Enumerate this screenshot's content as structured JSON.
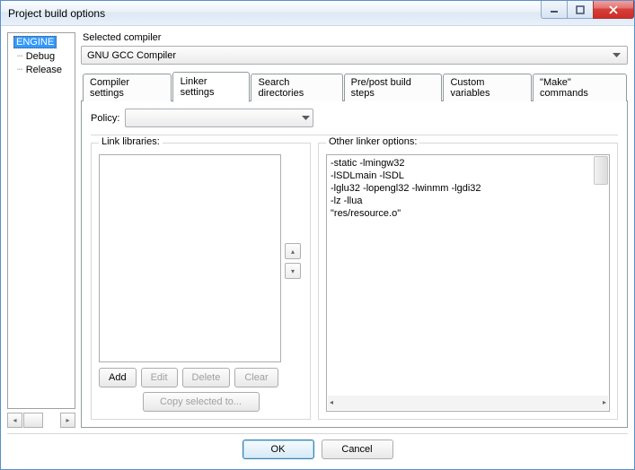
{
  "window": {
    "title": "Project build options"
  },
  "tree": {
    "root": "ENGINE",
    "children": [
      "Debug",
      "Release"
    ]
  },
  "compiler": {
    "label": "Selected compiler",
    "value": "GNU GCC Compiler"
  },
  "tabs": {
    "items": [
      "Compiler settings",
      "Linker settings",
      "Search directories",
      "Pre/post build steps",
      "Custom variables",
      "\"Make\" commands"
    ],
    "active_index": 1
  },
  "policy": {
    "label": "Policy:"
  },
  "link_libraries": {
    "legend": "Link libraries:",
    "buttons": {
      "add": "Add",
      "edit": "Edit",
      "delete": "Delete",
      "clear": "Clear"
    },
    "copy": "Copy selected to..."
  },
  "other_options": {
    "legend": "Other linker options:",
    "lines": [
      "-static -lmingw32",
      "-lSDLmain -lSDL",
      "-lglu32 -lopengl32 -lwinmm -lgdi32",
      "-lz -llua",
      "\"res/resource.o\""
    ]
  },
  "buttons": {
    "ok": "OK",
    "cancel": "Cancel"
  }
}
